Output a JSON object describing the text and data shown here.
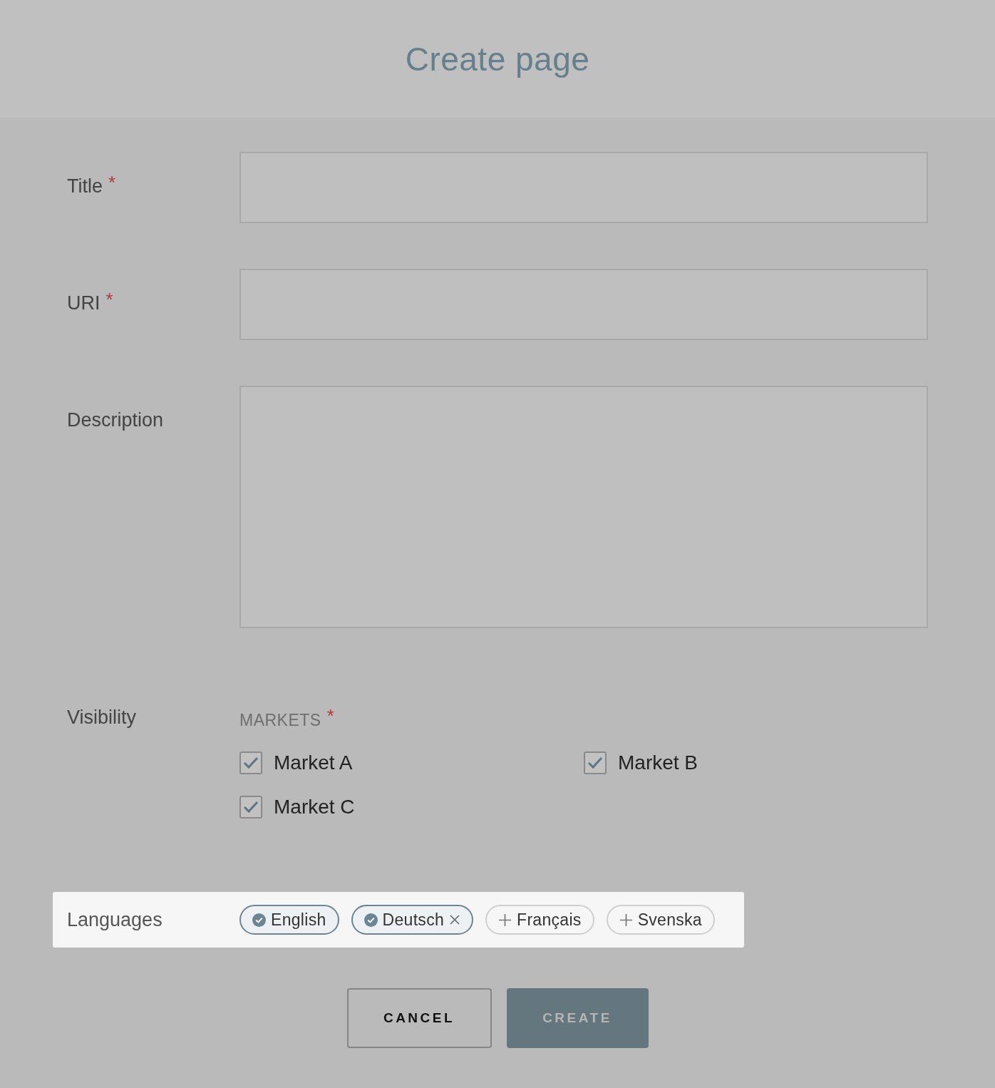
{
  "header": {
    "title": "Create page"
  },
  "fields": [
    {
      "label": "Title",
      "required_mark": "*",
      "kind": "input"
    },
    {
      "label": "URI",
      "required_mark": "*",
      "kind": "input"
    },
    {
      "label": "Description",
      "kind": "textarea"
    }
  ],
  "visibility": {
    "label": "Visibility",
    "markets_label": "MARKETS",
    "required_mark": "*",
    "markets": [
      {
        "label": "Market A",
        "checked": true
      },
      {
        "label": "Market B",
        "checked": true
      },
      {
        "label": "Market C",
        "checked": true
      }
    ]
  },
  "languages": {
    "label": "Languages",
    "items": [
      {
        "label": "English",
        "selected": true,
        "removable": false
      },
      {
        "label": "Deutsch",
        "selected": true,
        "removable": true
      },
      {
        "label": "Français",
        "selected": false,
        "removable": false
      },
      {
        "label": "Svenska",
        "selected": false,
        "removable": false
      }
    ]
  },
  "actions": [
    {
      "label": "CANCEL",
      "kind": "secondary",
      "disabled": false
    },
    {
      "label": "CREATE",
      "kind": "primary",
      "disabled": true
    }
  ]
}
